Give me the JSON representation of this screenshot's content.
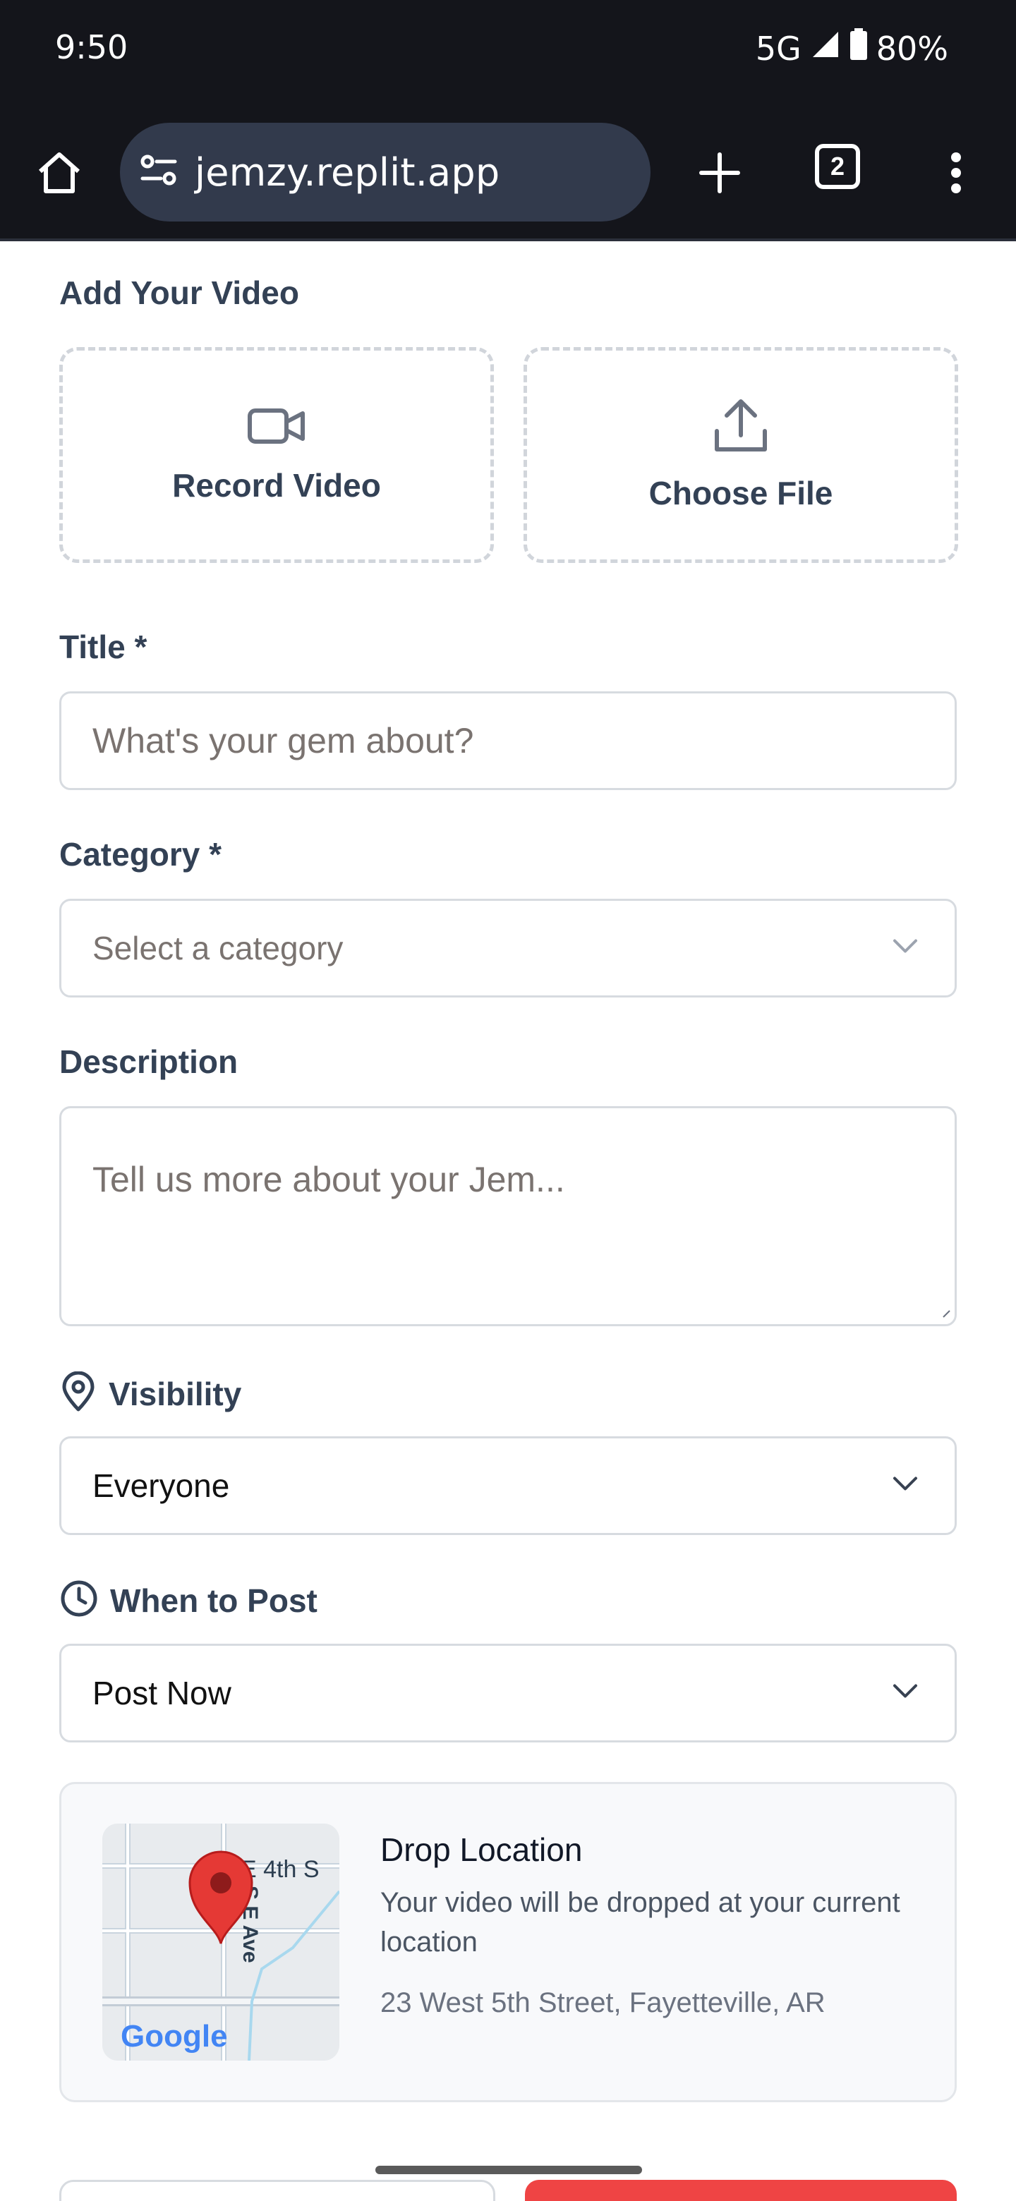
{
  "status_bar": {
    "time": "9:50",
    "network": "5G",
    "battery": "80%"
  },
  "browser": {
    "url": "jemzy.replit.app",
    "tab_count": "2"
  },
  "form": {
    "video_section_label": "Add Your Video",
    "record_video_label": "Record Video",
    "choose_file_label": "Choose File",
    "title_label": "Title *",
    "title_placeholder": "What's your gem about?",
    "category_label": "Category *",
    "category_placeholder": "Select a category",
    "description_label": "Description",
    "description_placeholder": "Tell us more about your Jem...",
    "visibility_label": "Visibility",
    "visibility_value": "Everyone",
    "when_to_post_label": "When to Post",
    "when_to_post_value": "Post Now"
  },
  "drop_location": {
    "title": "Drop Location",
    "description": "Your video will be dropped at your current location",
    "address": "23 West 5th Street, Fayetteville, AR",
    "map_street_1": "E 4th S",
    "map_street_2": "S E Ave",
    "map_logo": "Google"
  },
  "colors": {
    "browser_bg": "#14151b",
    "url_pill": "#323a4c",
    "label_text": "#334155",
    "submit_button": "#ef4444",
    "pin_red": "#e53935"
  }
}
